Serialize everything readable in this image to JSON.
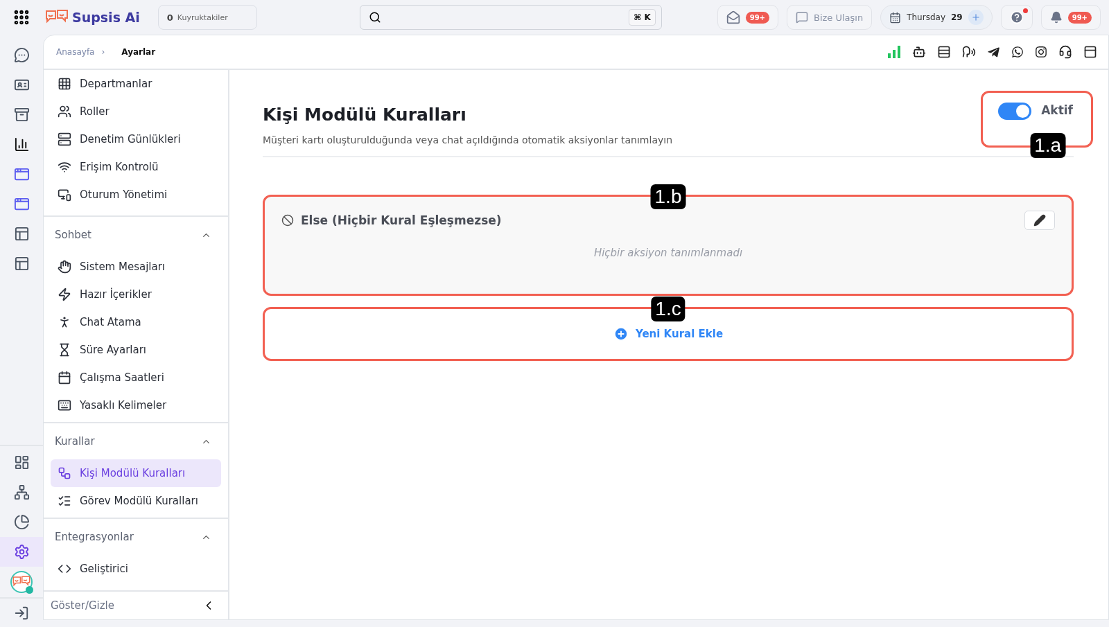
{
  "top_bar": {
    "brand": "Supsis Ai",
    "queue": {
      "count": "0",
      "label": "Kuyruktakiler"
    },
    "search": {
      "shortcut": "⌘ K"
    },
    "mail_badge": "99+",
    "contact_button": "Bize Ulaşın",
    "date": {
      "day": "Thursday",
      "number": "29"
    },
    "help_dot": true,
    "notification_badge": "99+"
  },
  "rail": {
    "top_items": [
      {
        "selected": false
      },
      {
        "selected": false
      },
      {
        "selected": false
      },
      {
        "selected": false
      },
      {
        "selected": false
      },
      {
        "selected": false
      },
      {
        "selected": false
      },
      {
        "selected": false
      }
    ],
    "bottom_items": [
      {
        "selected": false
      },
      {
        "selected": false
      },
      {
        "selected": false
      },
      {
        "selected": true
      }
    ],
    "status_online": true
  },
  "breadcrumb": {
    "items": [
      "Anasayfa",
      "Ayarlar"
    ],
    "separator": "›"
  },
  "sidebar": {
    "groups": [
      {
        "items": [
          {
            "label": "Departmanlar",
            "selected": false
          },
          {
            "label": "Roller",
            "selected": false
          },
          {
            "label": "Denetim Günlükleri",
            "selected": false
          },
          {
            "label": "Erişim Kontrolü",
            "selected": false
          },
          {
            "label": "Oturum Yönetimi",
            "selected": false
          }
        ]
      },
      {
        "title": "Sohbet",
        "expanded": true,
        "items": [
          {
            "label": "Sistem Mesajları",
            "selected": false
          },
          {
            "label": "Hazır İçerikler",
            "selected": false
          },
          {
            "label": "Chat Atama",
            "selected": false
          },
          {
            "label": "Süre Ayarları",
            "selected": false
          },
          {
            "label": "Çalışma Saatleri",
            "selected": false
          },
          {
            "label": "Yasaklı Kelimeler",
            "selected": false
          }
        ]
      },
      {
        "title": "Kurallar",
        "expanded": true,
        "items": [
          {
            "label": "Kişi Modülü Kuralları",
            "selected": true
          },
          {
            "label": "Görev Modülü Kuralları",
            "selected": false
          }
        ]
      },
      {
        "title": "Entegrasyonlar",
        "expanded": true,
        "items": [
          {
            "label": "Geliştirici",
            "selected": false
          }
        ]
      }
    ],
    "footer": "Göster/Gizle"
  },
  "page": {
    "title": "Kişi Modülü Kuralları",
    "subtitle": "Müşteri kartı oluşturulduğunda veya chat açıldığında otomatik aksiyonlar tanımlayın",
    "toggle": {
      "label": "Aktif",
      "on": true,
      "annotation": "1.a"
    },
    "rules": [
      {
        "title": "Else (Hiçbir Kural Eşleşmezse)",
        "empty_text": "Hiçbir aksiyon tanımlanmadı",
        "annotation": "1.b"
      }
    ],
    "add_button": {
      "label": "Yeni Kural Ekle",
      "annotation": "1.c"
    }
  }
}
